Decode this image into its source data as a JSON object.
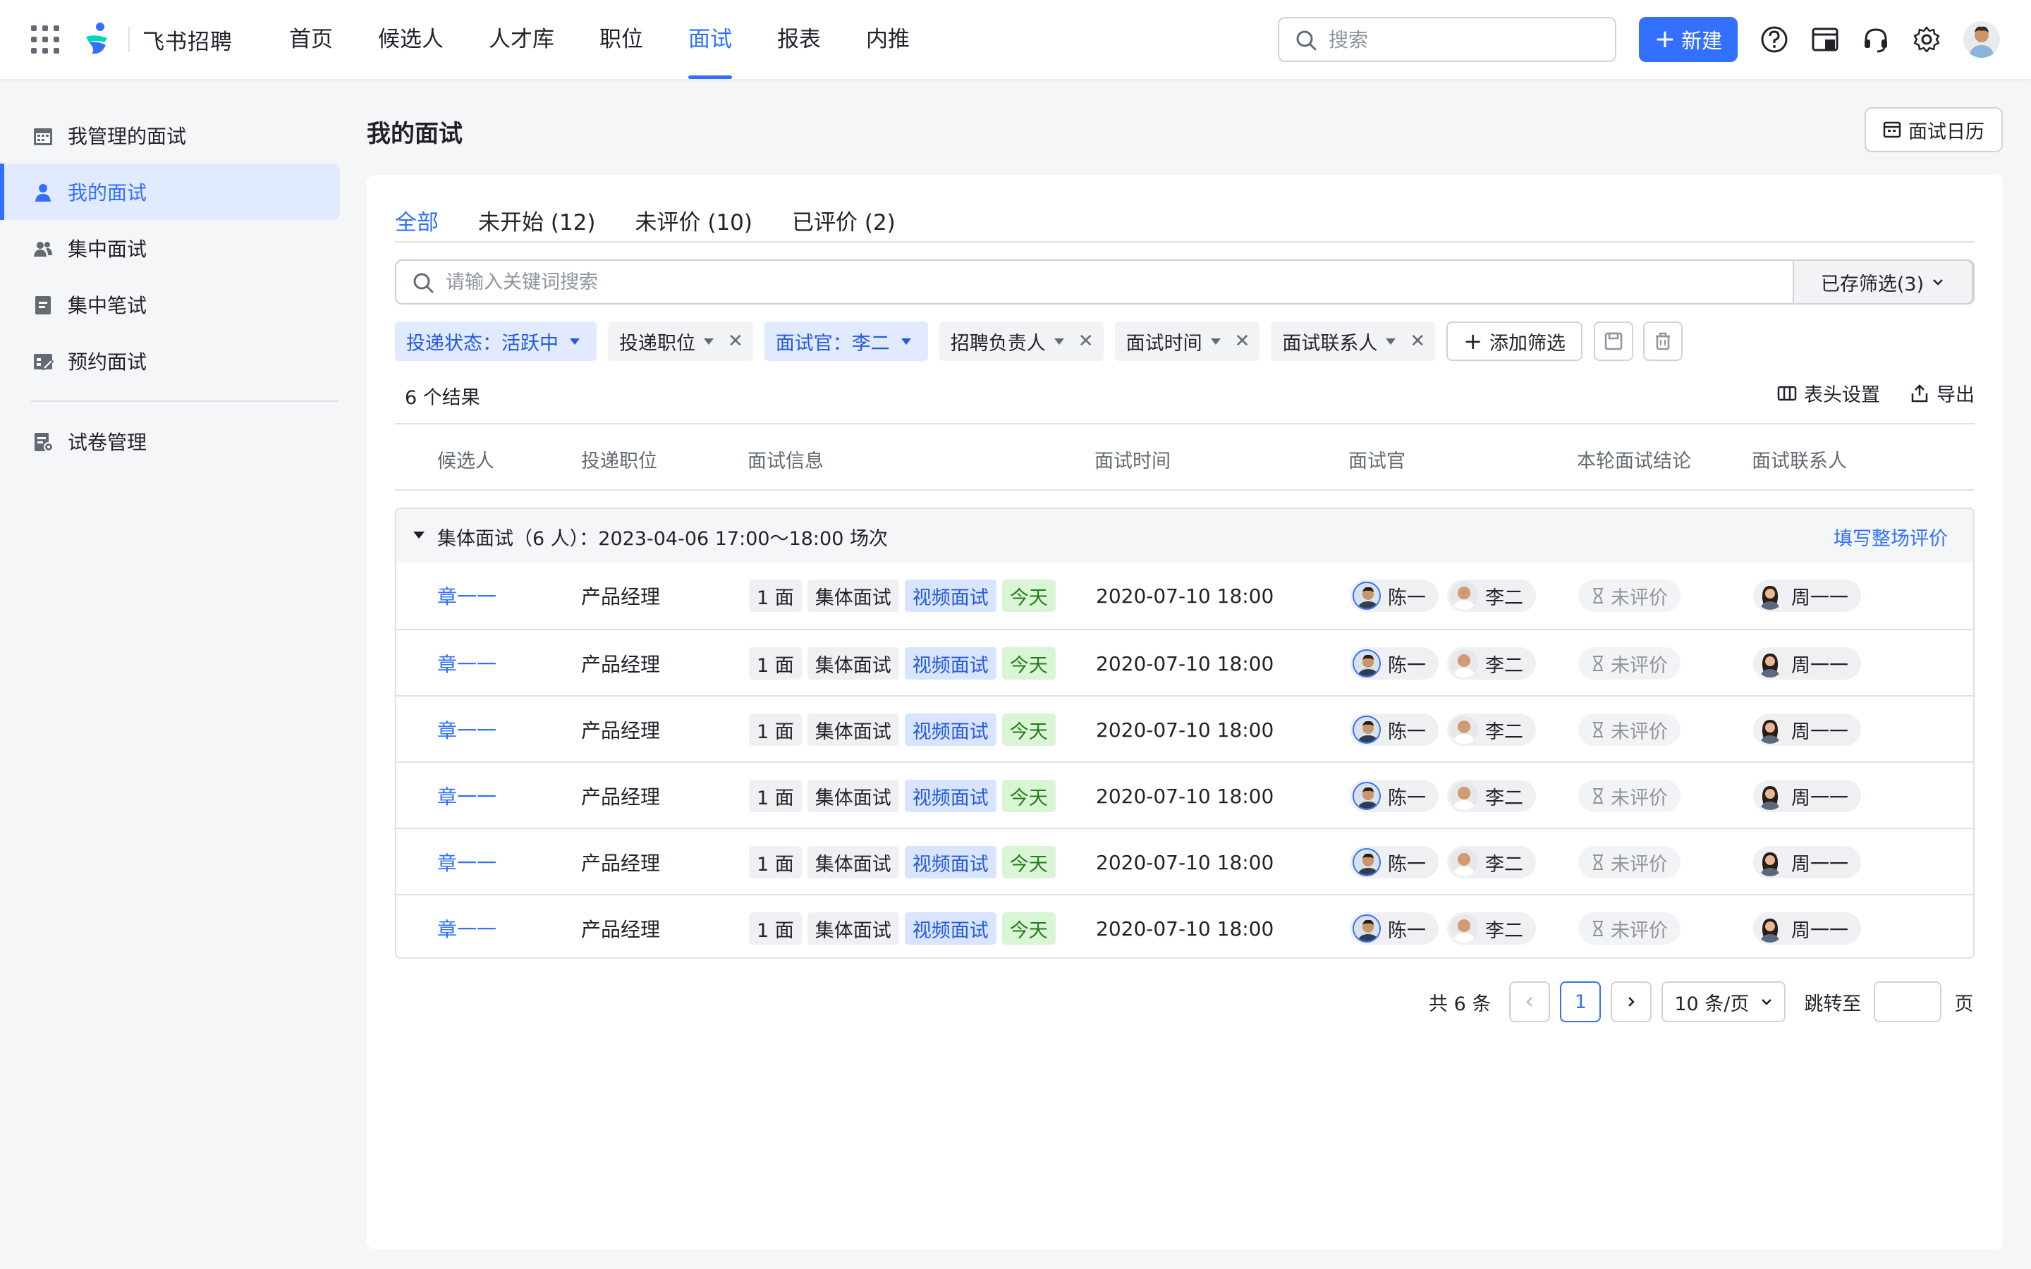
{
  "app": {
    "brand": "飞书招聘",
    "nav": [
      "首页",
      "候选人",
      "人才库",
      "职位",
      "面试",
      "报表",
      "内推"
    ],
    "nav_active": "面试",
    "search_placeholder": "搜索",
    "new_button": "新建"
  },
  "sidebar": {
    "items": [
      {
        "label": "我管理的面试",
        "icon": "calendar-icon"
      },
      {
        "label": "我的面试",
        "icon": "person-icon"
      },
      {
        "label": "集中面试",
        "icon": "group-icon"
      },
      {
        "label": "集中笔试",
        "icon": "document-icon"
      },
      {
        "label": "预约面试",
        "icon": "booking-icon"
      },
      {
        "label": "试卷管理",
        "icon": "exam-icon"
      }
    ]
  },
  "page": {
    "title": "我的面试",
    "calendar_button": "面试日历"
  },
  "tabs": [
    "全部",
    "未开始 (12)",
    "未评价 (10)",
    "已评价 (2)"
  ],
  "search": {
    "placeholder": "请输入关键词搜索",
    "saved_filters": "已存筛选(3)"
  },
  "filters": {
    "chips": [
      "投递状态：活跃中",
      "投递职位",
      "面试官：李二",
      "招聘负责人",
      "面试时间",
      "面试联系人"
    ],
    "add": "添加筛选"
  },
  "results": {
    "count": "6 个结果",
    "column_settings": "表头设置",
    "export": "导出"
  },
  "table": {
    "headers": [
      "候选人",
      "投递职位",
      "面试信息",
      "面试时间",
      "面试官",
      "本轮面试结论",
      "面试联系人"
    ],
    "group_title": "集体面试（6 人）：2023-04-06 17:00～18:00 场次",
    "group_action": "填写整场评价",
    "rows": [
      {
        "candidate": "章一一",
        "position": "产品经理",
        "tags": [
          "1 面",
          "集体面试",
          "视频面试",
          "今天"
        ],
        "time": "2020-07-10 18:00",
        "interviewers": [
          "陈一",
          "李二"
        ],
        "result": "未评价",
        "contact": "周一一"
      },
      {
        "candidate": "章一一",
        "position": "产品经理",
        "tags": [
          "1 面",
          "集体面试",
          "视频面试",
          "今天"
        ],
        "time": "2020-07-10 18:00",
        "interviewers": [
          "陈一",
          "李二"
        ],
        "result": "未评价",
        "contact": "周一一"
      },
      {
        "candidate": "章一一",
        "position": "产品经理",
        "tags": [
          "1 面",
          "集体面试",
          "视频面试",
          "今天"
        ],
        "time": "2020-07-10 18:00",
        "interviewers": [
          "陈一",
          "李二"
        ],
        "result": "未评价",
        "contact": "周一一"
      },
      {
        "candidate": "章一一",
        "position": "产品经理",
        "tags": [
          "1 面",
          "集体面试",
          "视频面试",
          "今天"
        ],
        "time": "2020-07-10 18:00",
        "interviewers": [
          "陈一",
          "李二"
        ],
        "result": "未评价",
        "contact": "周一一"
      },
      {
        "candidate": "章一一",
        "position": "产品经理",
        "tags": [
          "1 面",
          "集体面试",
          "视频面试",
          "今天"
        ],
        "time": "2020-07-10 18:00",
        "interviewers": [
          "陈一",
          "李二"
        ],
        "result": "未评价",
        "contact": "周一一"
      },
      {
        "candidate": "章一一",
        "position": "产品经理",
        "tags": [
          "1 面",
          "集体面试",
          "视频面试",
          "今天"
        ],
        "time": "2020-07-10 18:00",
        "interviewers": [
          "陈一",
          "李二"
        ],
        "result": "未评价",
        "contact": "周一一"
      }
    ]
  },
  "pagination": {
    "total": "共 6 条",
    "current": "1",
    "page_size": "10 条/页",
    "jump_label": "跳转至",
    "page_suffix": "页"
  },
  "colors": {
    "primary": "#3370ff",
    "active_bg": "#e1eaff",
    "tag_blue_bg": "#d9e4ff",
    "tag_green_bg": "#d9f5d6"
  }
}
